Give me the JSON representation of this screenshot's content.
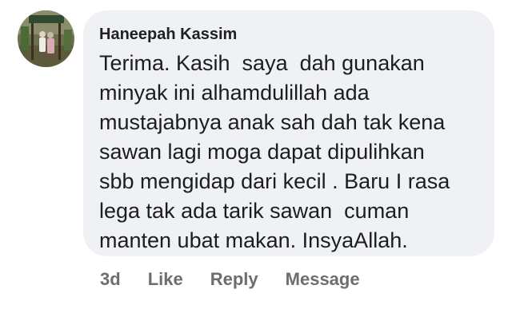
{
  "comment": {
    "author": "Haneepah Kassim",
    "text_lines": [
      "Terima. Kasih  saya  dah gunakan",
      "minyak ini alhamdulillah ada",
      "mustajabnya anak sah dah tak kena",
      "sawan lagi moga dapat dipulihkan",
      "sbb mengidap dari kecil . Baru I rasa",
      "lega tak ada tarik sawan  cuman",
      "manten ubat makan. InsyaAllah."
    ],
    "avatar_icon": "profile-photo-avatar"
  },
  "actions": {
    "timestamp": "3d",
    "like_label": "Like",
    "reply_label": "Reply",
    "message_label": "Message"
  },
  "colors": {
    "bubble_background": "#eff1f4",
    "action_text": "#6a6d72",
    "body_text": "#1c1d20"
  }
}
